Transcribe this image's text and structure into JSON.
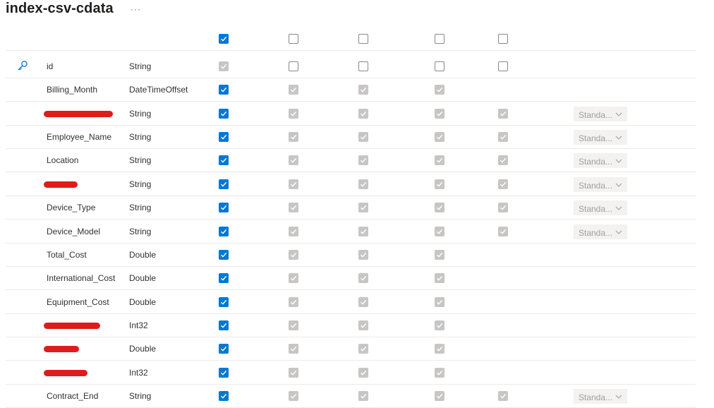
{
  "title": "index-csv-cdata",
  "more_label": "···",
  "icons": {
    "key": "key-icon",
    "checkmark": "checkmark-icon",
    "chevron": "chevron-down-icon"
  },
  "colors": {
    "accent": "#0078d4",
    "disabled": "#c8c6c4",
    "redaction": "#e01b1b",
    "separator": "#edebe9"
  },
  "header_row": {
    "checkboxes": [
      "on",
      "off",
      "off",
      "off",
      "off"
    ]
  },
  "rows": [
    {
      "name": "id",
      "type": "String",
      "key": true,
      "checkboxes": [
        "dis",
        "off",
        "off",
        "off",
        "off"
      ],
      "dropdown": ""
    },
    {
      "name": "Billing_Month",
      "type": "DateTimeOffset",
      "checkboxes": [
        "on",
        "dis",
        "dis",
        "dis"
      ],
      "dropdown": ""
    },
    {
      "name": "",
      "redacted": true,
      "type": "String",
      "checkboxes": [
        "on",
        "dis",
        "dis",
        "dis",
        "dis"
      ],
      "dropdown": "Standa..."
    },
    {
      "name": "Employee_Name",
      "type": "String",
      "checkboxes": [
        "on",
        "dis",
        "dis",
        "dis",
        "dis"
      ],
      "dropdown": "Standa..."
    },
    {
      "name": "Location",
      "type": "String",
      "checkboxes": [
        "on",
        "dis",
        "dis",
        "dis",
        "dis"
      ],
      "dropdown": "Standa..."
    },
    {
      "name": "",
      "redacted": true,
      "type": "String",
      "checkboxes": [
        "on",
        "dis",
        "dis",
        "dis",
        "dis"
      ],
      "dropdown": "Standa..."
    },
    {
      "name": "Device_Type",
      "type": "String",
      "checkboxes": [
        "on",
        "dis",
        "dis",
        "dis",
        "dis"
      ],
      "dropdown": "Standa..."
    },
    {
      "name": "Device_Model",
      "type": "String",
      "checkboxes": [
        "on",
        "dis",
        "dis",
        "dis",
        "dis"
      ],
      "dropdown": "Standa..."
    },
    {
      "name": "Total_Cost",
      "type": "Double",
      "checkboxes": [
        "on",
        "dis",
        "dis",
        "dis"
      ],
      "dropdown": ""
    },
    {
      "name": "International_Cost",
      "type": "Double",
      "checkboxes": [
        "on",
        "dis",
        "dis",
        "dis"
      ],
      "dropdown": ""
    },
    {
      "name": "Equipment_Cost",
      "type": "Double",
      "checkboxes": [
        "on",
        "dis",
        "dis",
        "dis"
      ],
      "dropdown": ""
    },
    {
      "name": "",
      "redacted": true,
      "type": "Int32",
      "checkboxes": [
        "on",
        "dis",
        "dis",
        "dis"
      ],
      "dropdown": ""
    },
    {
      "name": "",
      "redacted": true,
      "type": "Double",
      "checkboxes": [
        "on",
        "dis",
        "dis",
        "dis"
      ],
      "dropdown": ""
    },
    {
      "name": "",
      "redacted": true,
      "type": "Int32",
      "checkboxes": [
        "on",
        "dis",
        "dis",
        "dis"
      ],
      "dropdown": ""
    },
    {
      "name": "Contract_End",
      "type": "String",
      "checkboxes": [
        "on",
        "dis",
        "dis",
        "dis",
        "dis"
      ],
      "dropdown": "Standa..."
    }
  ]
}
